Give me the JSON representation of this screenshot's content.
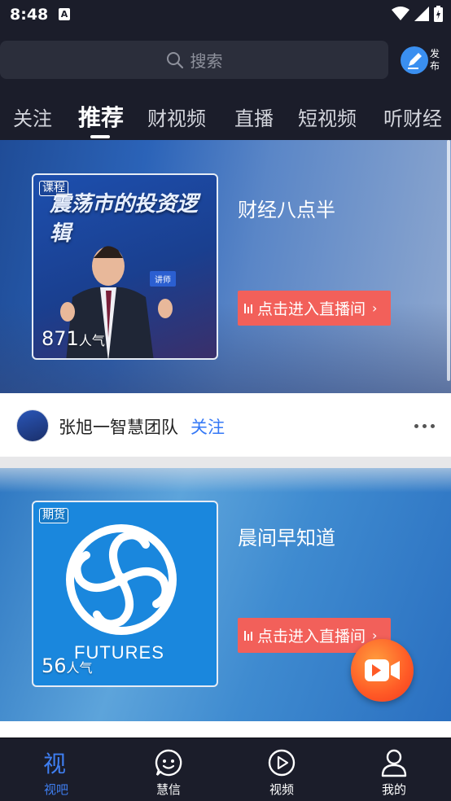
{
  "status_bar": {
    "time": "8:48",
    "notification_badge": "A"
  },
  "header": {
    "search_placeholder": "搜索",
    "publish_label": "发布"
  },
  "tabs": [
    {
      "label": "关注",
      "active": false
    },
    {
      "label": "推荐",
      "active": true
    },
    {
      "label": "财视频",
      "active": false
    },
    {
      "label": "直播",
      "active": false
    },
    {
      "label": "短视频",
      "active": false
    },
    {
      "label": "听财经",
      "active": false
    }
  ],
  "feed": [
    {
      "badge": "课程",
      "views_count": "871",
      "views_unit": "人气",
      "title": "财经八点半",
      "enter_label": "点击进入直播间",
      "thumb_text": "震荡市的投资逻辑",
      "author": "张旭一智慧团队",
      "follow_label": "关注"
    },
    {
      "badge": "期货",
      "views_count": "56",
      "views_unit": "人气",
      "title": "晨间早知道",
      "enter_label": "点击进入直播间",
      "thumb_text": "FUTURES"
    }
  ],
  "bottom_nav": [
    {
      "label": "视吧",
      "icon": "shiba-icon",
      "active": true
    },
    {
      "label": "慧信",
      "icon": "chat-icon",
      "active": false
    },
    {
      "label": "视频",
      "icon": "play-icon",
      "active": false
    },
    {
      "label": "我的",
      "icon": "user-icon",
      "active": false
    }
  ],
  "colors": {
    "background": "#1b1d2a",
    "accent_blue": "#3478f6",
    "nav_active": "#3f7ff2",
    "enter_button": "#f2605a",
    "fab_orange": "#ff5a26"
  }
}
